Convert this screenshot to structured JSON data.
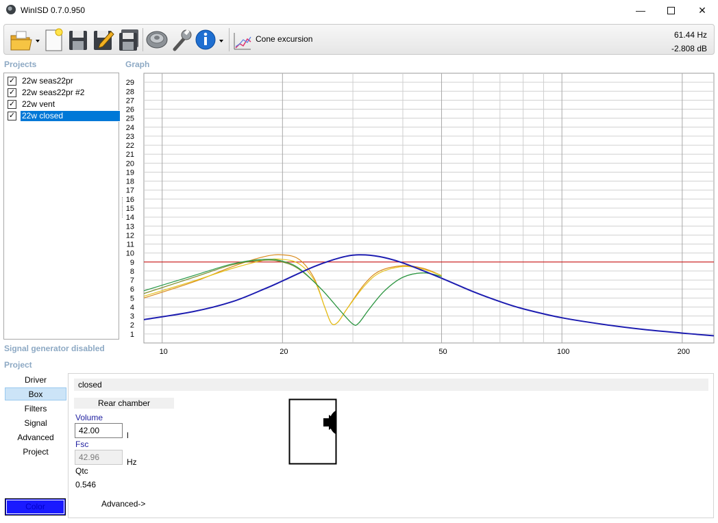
{
  "window": {
    "title": "WinISD 0.7.0.950",
    "min_glyph": "—",
    "close_glyph": "✕"
  },
  "toolbar": {
    "icons": [
      "open-folder-icon",
      "new-project-icon",
      "save-icon",
      "edit-save-icon",
      "save-all-icon",
      "driver-icon",
      "tools-icon",
      "info-icon"
    ],
    "graph_icon": "graph-chart-icon",
    "graph_label": "Cone excursion",
    "readout_freq": "61.44 Hz",
    "readout_level": "-2.808 dB"
  },
  "sections": {
    "projects": "Projects",
    "graph": "Graph",
    "signal": "Signal generator disabled",
    "project": "Project"
  },
  "projects": [
    {
      "label": "22w seas22pr",
      "checked": true,
      "selected": false
    },
    {
      "label": "22w seas22pr #2",
      "checked": true,
      "selected": false
    },
    {
      "label": "22w vent",
      "checked": true,
      "selected": false
    },
    {
      "label": "22w closed",
      "checked": true,
      "selected": true
    }
  ],
  "chart_data": {
    "type": "line",
    "x_scale": "log",
    "xlim": [
      9,
      240
    ],
    "ylim": [
      0,
      30
    ],
    "x_ticks": [
      10,
      20,
      50,
      100,
      200
    ],
    "y_ticks": [
      1,
      2,
      3,
      4,
      5,
      6,
      7,
      8,
      9,
      10,
      11,
      12,
      13,
      14,
      15,
      16,
      17,
      18,
      19,
      20,
      21,
      22,
      23,
      24,
      25,
      26,
      27,
      28,
      29
    ],
    "reference_line": {
      "y": 9.0,
      "color": "#cc0000"
    },
    "series": [
      {
        "color": "#d98a1a",
        "points": [
          [
            9,
            5.0
          ],
          [
            12,
            6.8
          ],
          [
            15,
            8.5
          ],
          [
            18,
            9.6
          ],
          [
            20,
            9.8
          ],
          [
            22,
            9.3
          ],
          [
            24,
            7.2
          ],
          [
            25.5,
            4.0
          ],
          [
            26.5,
            2.2
          ],
          [
            27.5,
            2.3
          ],
          [
            29,
            3.8
          ],
          [
            32,
            6.5
          ],
          [
            35,
            8.0
          ],
          [
            40,
            8.6
          ],
          [
            45,
            8.3
          ],
          [
            50,
            7.5
          ]
        ]
      },
      {
        "color": "#e6c21a",
        "points": [
          [
            9,
            5.2
          ],
          [
            12,
            6.9
          ],
          [
            15,
            8.3
          ],
          [
            18,
            9.2
          ],
          [
            20,
            9.3
          ],
          [
            22,
            8.8
          ],
          [
            24,
            7.0
          ],
          [
            25.5,
            4.0
          ],
          [
            26.5,
            2.2
          ],
          [
            27.5,
            2.3
          ],
          [
            29,
            3.8
          ],
          [
            32,
            6.3
          ],
          [
            35,
            7.8
          ],
          [
            40,
            8.5
          ],
          [
            45,
            8.2
          ],
          [
            50,
            7.5
          ]
        ]
      },
      {
        "color": "#7a8a2a",
        "points": [
          [
            9,
            5.5
          ],
          [
            12,
            7.3
          ],
          [
            15,
            8.7
          ],
          [
            18,
            9.2
          ],
          [
            20,
            9.0
          ],
          [
            22,
            8.2
          ],
          [
            25,
            6.0
          ],
          [
            28,
            3.5
          ],
          [
            30,
            2.1
          ],
          [
            31,
            2.2
          ],
          [
            33,
            3.8
          ],
          [
            36,
            5.8
          ],
          [
            40,
            7.3
          ],
          [
            45,
            7.8
          ],
          [
            50,
            7.4
          ]
        ]
      },
      {
        "color": "#2a9a4a",
        "points": [
          [
            9,
            5.8
          ],
          [
            12,
            7.5
          ],
          [
            15,
            8.8
          ],
          [
            18,
            9.3
          ],
          [
            20,
            9.1
          ],
          [
            22,
            8.3
          ],
          [
            25,
            6.0
          ],
          [
            28,
            3.5
          ],
          [
            30,
            2.1
          ],
          [
            31,
            2.2
          ],
          [
            33,
            3.8
          ],
          [
            36,
            5.8
          ],
          [
            40,
            7.3
          ],
          [
            45,
            7.8
          ],
          [
            50,
            7.4
          ]
        ]
      },
      {
        "color": "#1c1cb0",
        "points": [
          [
            9,
            2.6
          ],
          [
            12,
            3.5
          ],
          [
            15,
            4.6
          ],
          [
            18,
            6.0
          ],
          [
            20,
            6.9
          ],
          [
            24,
            8.5
          ],
          [
            28,
            9.5
          ],
          [
            31,
            9.8
          ],
          [
            35,
            9.6
          ],
          [
            40,
            8.9
          ],
          [
            50,
            7.2
          ],
          [
            60,
            5.7
          ],
          [
            70,
            4.6
          ],
          [
            80,
            3.8
          ],
          [
            100,
            2.8
          ],
          [
            130,
            2.0
          ],
          [
            160,
            1.5
          ],
          [
            200,
            1.1
          ],
          [
            240,
            0.8
          ]
        ]
      }
    ]
  },
  "nav": {
    "items": [
      "Driver",
      "Box",
      "Filters",
      "Signal",
      "Advanced",
      "Project"
    ],
    "active": "Box",
    "color_button": "Color"
  },
  "box_panel": {
    "name": "closed",
    "rear_chamber": "Rear chamber",
    "volume_label": "Volume",
    "volume_value": "42.00",
    "volume_unit": "l",
    "fsc_label": "Fsc",
    "fsc_value": "42.96",
    "fsc_unit": "Hz",
    "qtc_label": "Qtc",
    "qtc_value": "0.546",
    "advanced_link": "Advanced->"
  }
}
